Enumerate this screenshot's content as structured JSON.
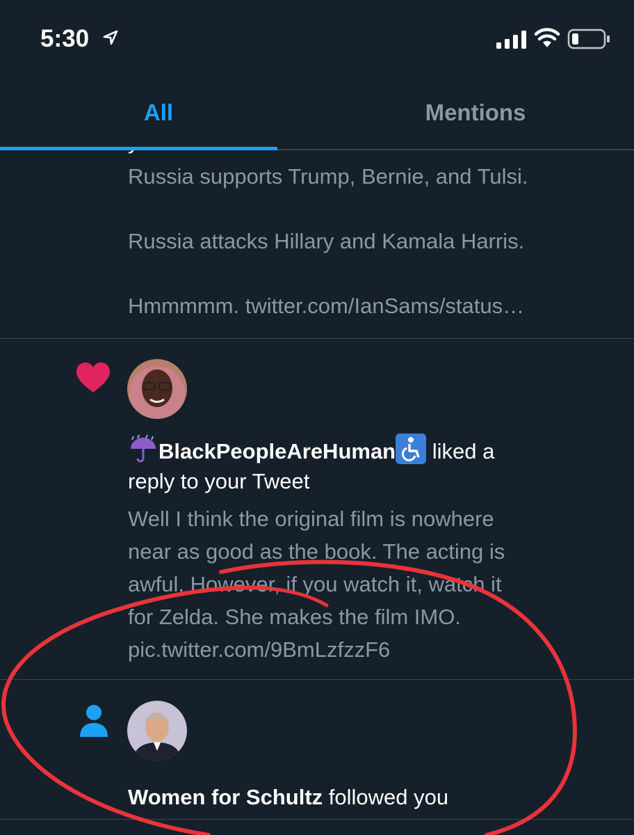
{
  "status_bar": {
    "time": "5:30"
  },
  "tabs": [
    {
      "label": "All",
      "active": true
    },
    {
      "label": "Mentions",
      "active": false
    }
  ],
  "notifications": [
    {
      "partial_header": "your Retweet",
      "lines": [
        "Russia supports Trump, Bernie, and Tulsi.",
        "Russia attacks Hillary and Kamala Harris.",
        "Hmmmmm. twitter.com/IanSams/status…"
      ]
    },
    {
      "icon": "heart-icon",
      "user": "BlackPeopleAreHuman",
      "action_1": "liked a",
      "action_2": "reply to your Tweet",
      "lines": [
        "Well I think the original film is nowhere",
        "near as good as the book. The acting is",
        "awful, However, if you watch it, watch it",
        "for Zelda. She makes the film IMO.",
        "pic.twitter.com/9BmLzfzzF6"
      ]
    },
    {
      "icon": "person-icon",
      "user": "Women for Schultz",
      "action": "followed you"
    }
  ],
  "colors": {
    "background": "#15202b",
    "accent": "#1da1f2",
    "secondary_text": "#8899a6",
    "like": "#e0245e",
    "annotation": "#e8343a"
  }
}
